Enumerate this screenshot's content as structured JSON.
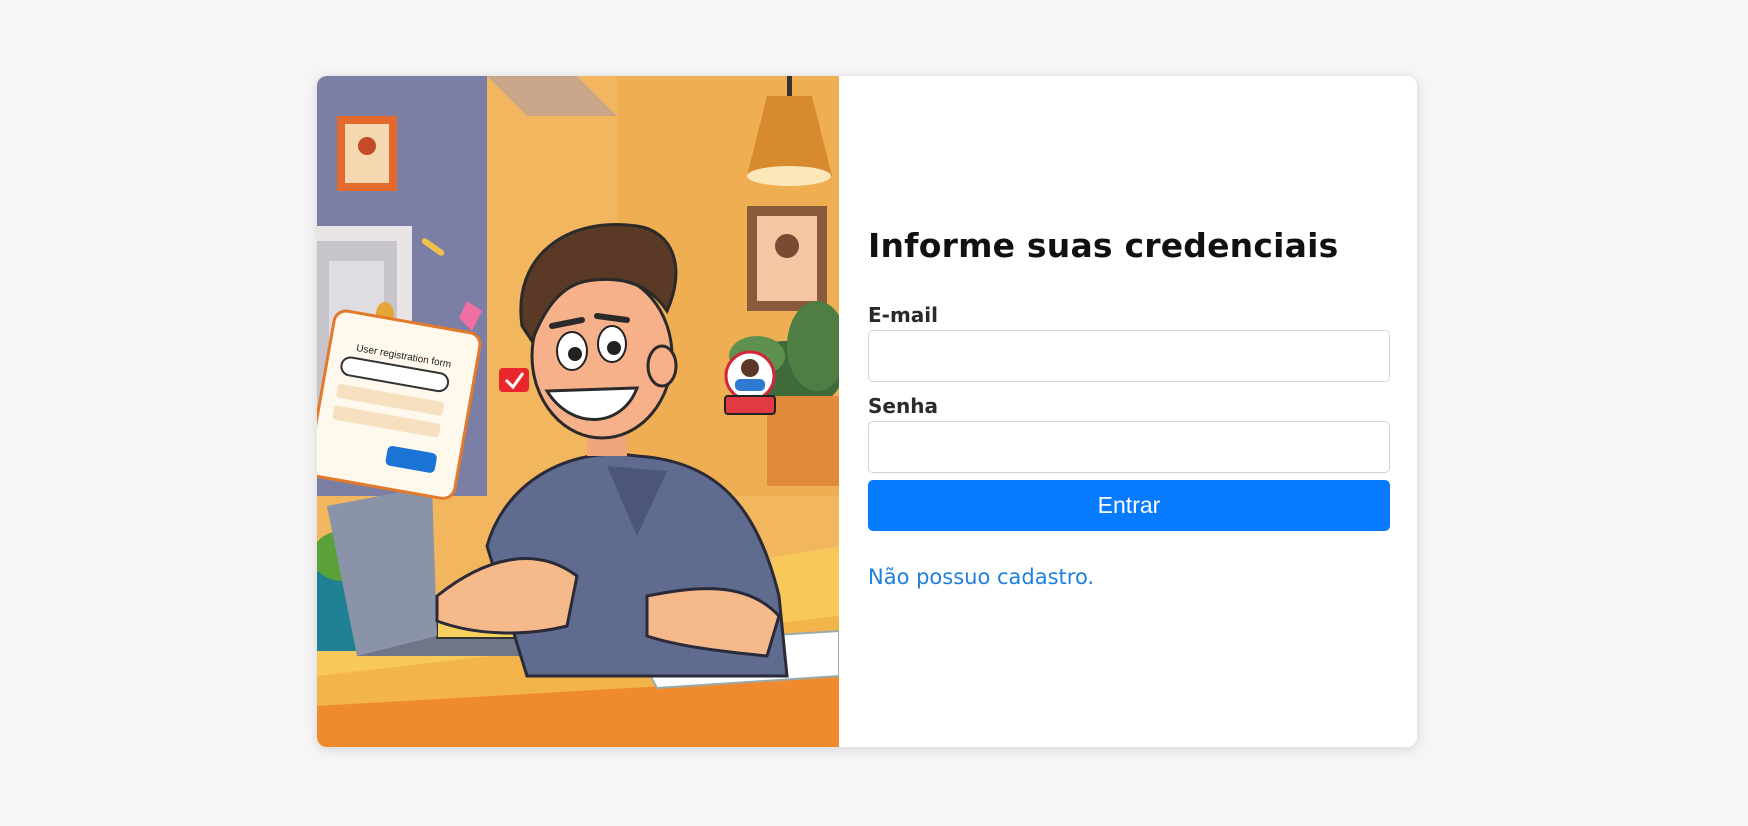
{
  "illustration": {
    "form_card_title": "User registration form"
  },
  "login": {
    "title": "Informe suas credenciais",
    "email_label": "E-mail",
    "email_value": "",
    "password_label": "Senha",
    "password_value": "",
    "submit_label": "Entrar",
    "register_link": "Não possuo cadastro."
  },
  "colors": {
    "page_bg": "#f6f6f6",
    "button_bg": "#077bff",
    "link": "#1f7fe0"
  }
}
